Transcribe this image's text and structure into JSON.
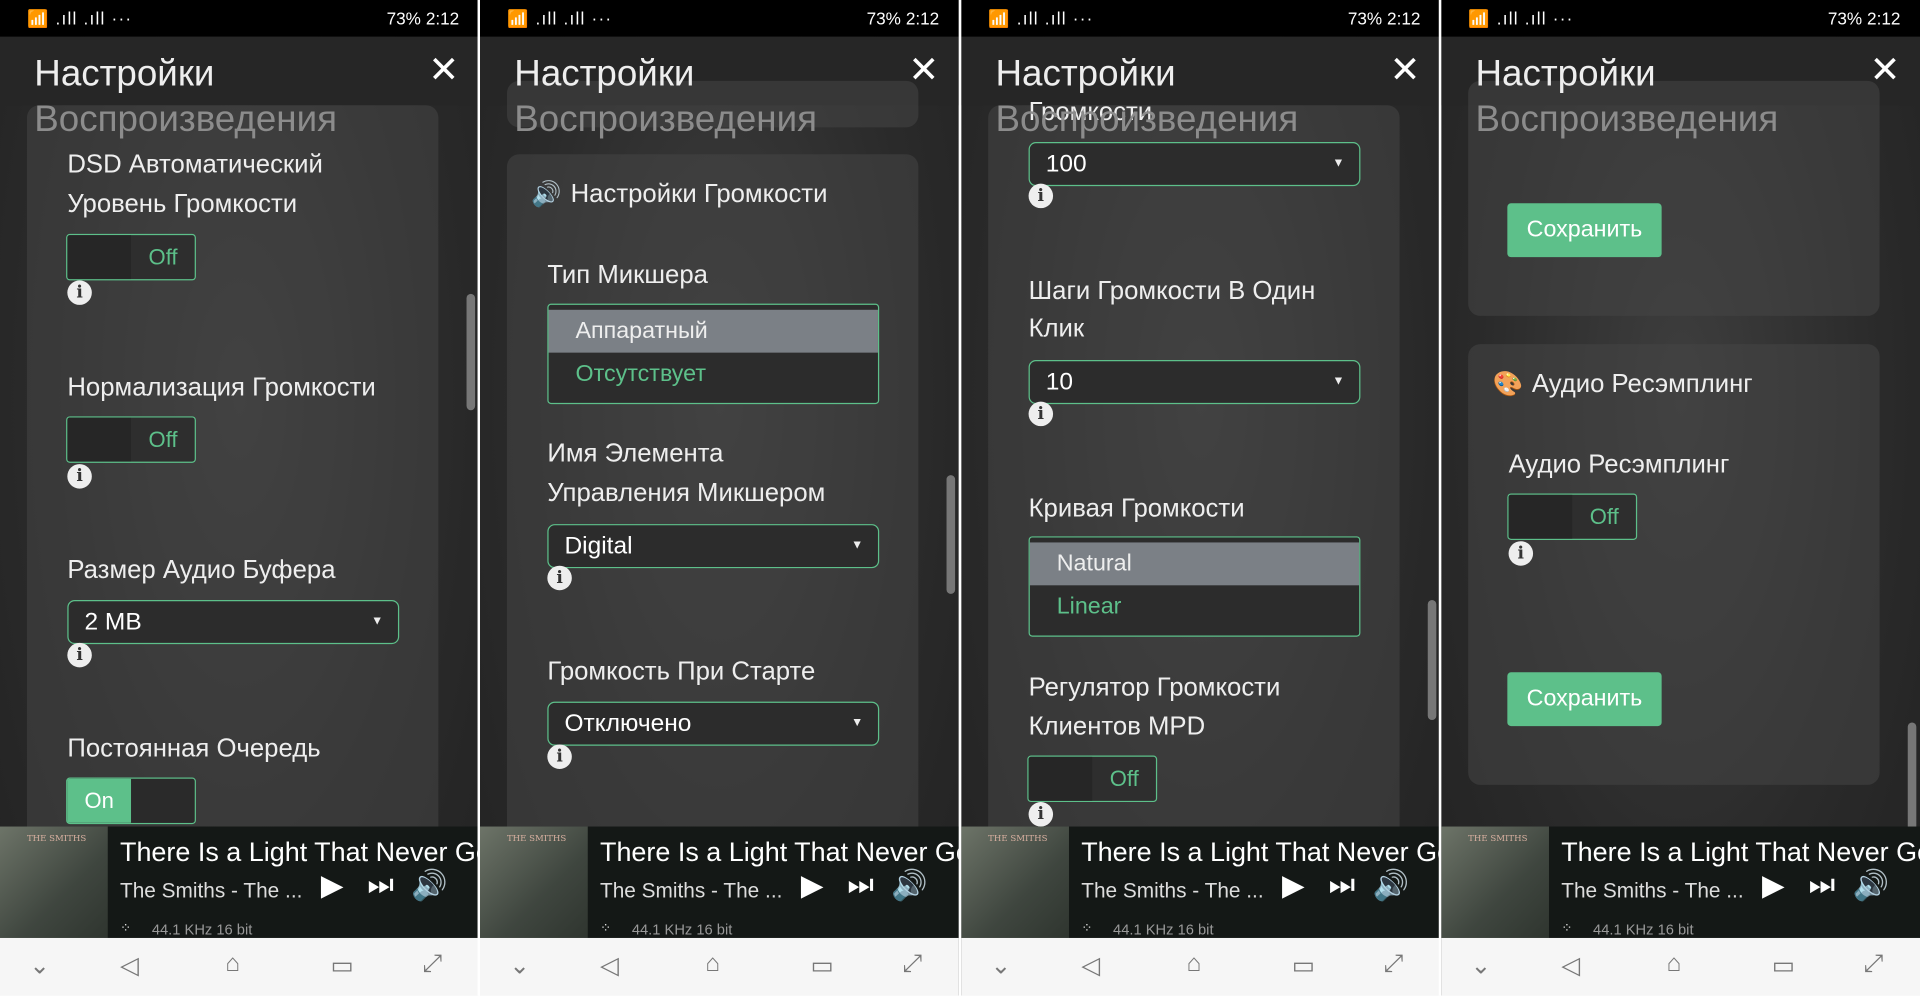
{
  "status_bar": {
    "left_icons": "wifi-icon signal-1-icon signal-2-icon",
    "battery": "73%",
    "time": "2:12"
  },
  "colors": {
    "accent": "#5dc08a",
    "selected_option": "#7b8086",
    "background": "#2a2a2a"
  },
  "player": {
    "title": "There Is a Light That Never Goes",
    "artist": "The Smiths - The ...",
    "quality": "44.1 KHz 16 bit",
    "album_art_text": "THE SMITHS"
  },
  "nav_icons": [
    "hide-keyboard-icon",
    "back-icon",
    "home-icon",
    "recents-icon",
    "fullscreen-icon"
  ],
  "panels": [
    {
      "title": "Настройки",
      "subtitle": "Воспроизведения",
      "items": [
        {
          "type": "label",
          "text": "DSD Автоматический"
        },
        {
          "type": "label",
          "text": "Уровень Громкости"
        },
        {
          "type": "toggle",
          "value": "Off"
        },
        {
          "type": "info"
        },
        {
          "type": "label",
          "text": "Нормализация Громкости"
        },
        {
          "type": "toggle",
          "value": "Off"
        },
        {
          "type": "info"
        },
        {
          "type": "label",
          "text": "Размер Аудио Буфера"
        },
        {
          "type": "select",
          "value": "2 MB"
        },
        {
          "type": "info"
        },
        {
          "type": "label",
          "text": "Постоянная Очередь"
        },
        {
          "type": "toggle",
          "value": "On"
        }
      ]
    },
    {
      "title": "Настройки",
      "subtitle": "Воспроизведения",
      "items": [
        {
          "type": "header",
          "icon": "speaker-icon",
          "text": "Настройки Громкости"
        },
        {
          "type": "label",
          "text": "Тип Микшера"
        },
        {
          "type": "list",
          "options": [
            "Аппаратный",
            "Отсутствует"
          ],
          "selected": 0
        },
        {
          "type": "label",
          "text": "Имя Элемента"
        },
        {
          "type": "label",
          "text": "Управления Микшером"
        },
        {
          "type": "select",
          "value": "Digital"
        },
        {
          "type": "info"
        },
        {
          "type": "label",
          "text": "Громкость При Старте"
        },
        {
          "type": "select",
          "value": "Отключено"
        },
        {
          "type": "info"
        }
      ]
    },
    {
      "title": "Настройки",
      "subtitle": "Воспроизведения",
      "items": [
        {
          "type": "label",
          "text": "Громкости"
        },
        {
          "type": "select",
          "value": "100"
        },
        {
          "type": "info"
        },
        {
          "type": "label",
          "text": "Шаги Громкости В Один"
        },
        {
          "type": "label",
          "text": "Клик"
        },
        {
          "type": "select",
          "value": "10"
        },
        {
          "type": "info"
        },
        {
          "type": "label",
          "text": "Кривая Громкости"
        },
        {
          "type": "list",
          "options": [
            "Natural",
            "Linear"
          ],
          "selected": 0
        },
        {
          "type": "label",
          "text": "Регулятор Громкости"
        },
        {
          "type": "label",
          "text": "Клиентов MPD"
        },
        {
          "type": "toggle",
          "value": "Off"
        },
        {
          "type": "info"
        }
      ]
    },
    {
      "title": "Настройки",
      "subtitle": "Воспроизведения",
      "items": [
        {
          "type": "button",
          "label": "Сохранить"
        },
        {
          "type": "header",
          "icon": "palette-icon",
          "text": "Аудио Ресэмплинг"
        },
        {
          "type": "label",
          "text": "Аудио Ресэмплинг"
        },
        {
          "type": "toggle",
          "value": "Off"
        },
        {
          "type": "info"
        },
        {
          "type": "button",
          "label": "Сохранить"
        }
      ]
    }
  ]
}
